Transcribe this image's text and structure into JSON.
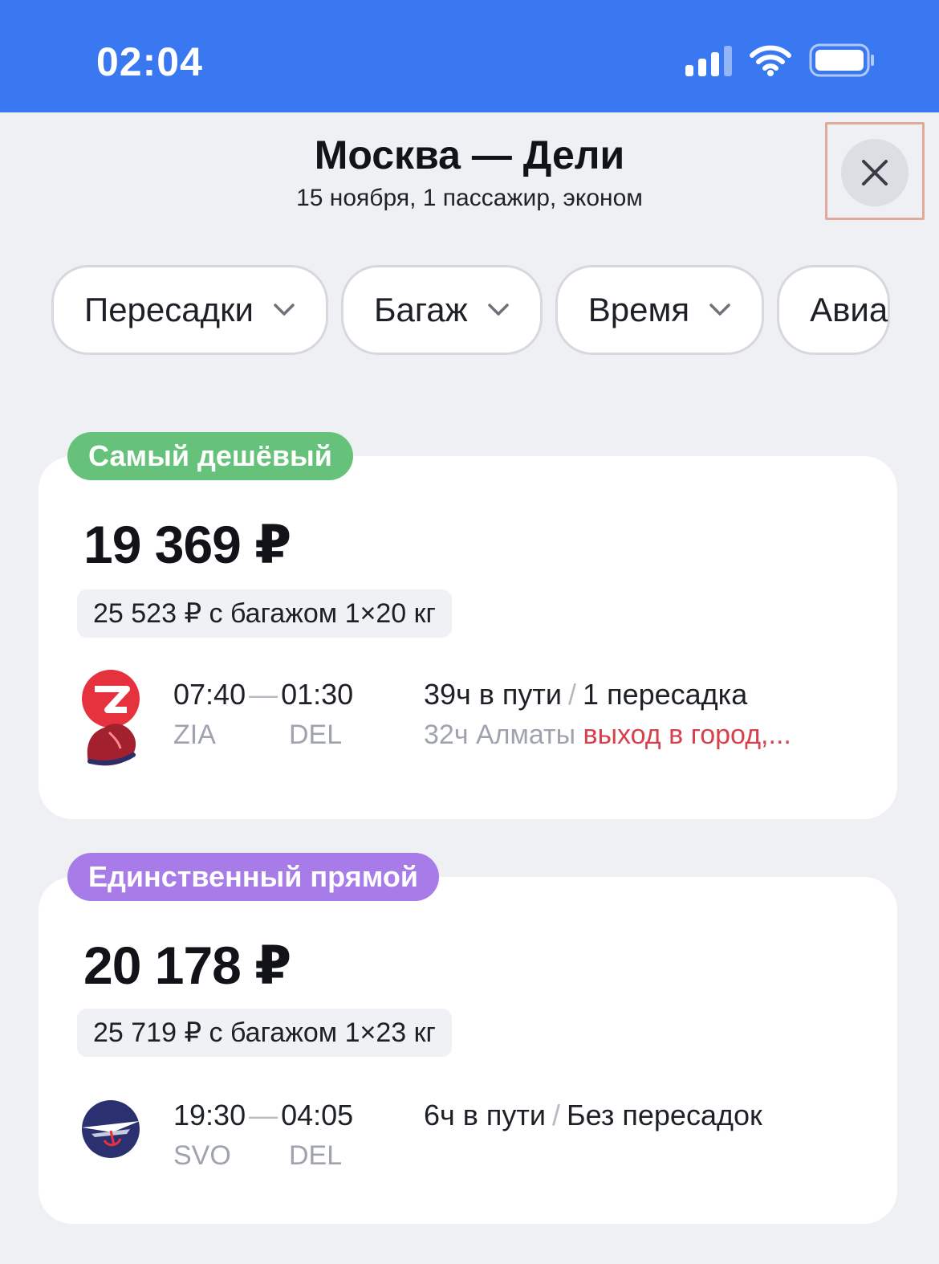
{
  "status_bar": {
    "time": "02:04",
    "bg": "#3a78f2"
  },
  "header": {
    "title": "Москва — Дели",
    "subtitle": "15 ноября, 1 пассажир, эконом",
    "close_icon": "close-icon"
  },
  "filters": [
    {
      "label": "Пересадки",
      "icon": "chevron-down-icon"
    },
    {
      "label": "Багаж",
      "icon": "chevron-down-icon"
    },
    {
      "label": "Время",
      "icon": "chevron-down-icon"
    },
    {
      "label": "Авиа"
    }
  ],
  "offers": [
    {
      "badge": "Самый дешёвый",
      "badge_color": "#66c27a",
      "price": "19 369 ₽",
      "baggage": "25 523 ₽ с багажом 1×20 кг",
      "dep_time": "07:40",
      "arr_time": "01:30",
      "dep_code": "ZIA",
      "arr_code": "DEL",
      "duration": "39ч в пути",
      "stops": "1 пересадка",
      "stop_info": "32ч Алматы",
      "stop_warning": "выход в город,...",
      "airline_logo": "red-lion-airline-logo"
    },
    {
      "badge": "Единственный прямой",
      "badge_color": "#a77ce8",
      "price": "20 178 ₽",
      "baggage": "25 719 ₽ с багажом 1×23 кг",
      "dep_time": "19:30",
      "arr_time": "04:05",
      "dep_code": "SVO",
      "arr_code": "DEL",
      "duration": "6ч в пути",
      "stops": "Без пересадок",
      "airline_logo": "aeroflot-logo"
    }
  ],
  "colors": {
    "background": "#eef0f4",
    "warning": "#d6414e",
    "muted": "#9ea3ad"
  }
}
